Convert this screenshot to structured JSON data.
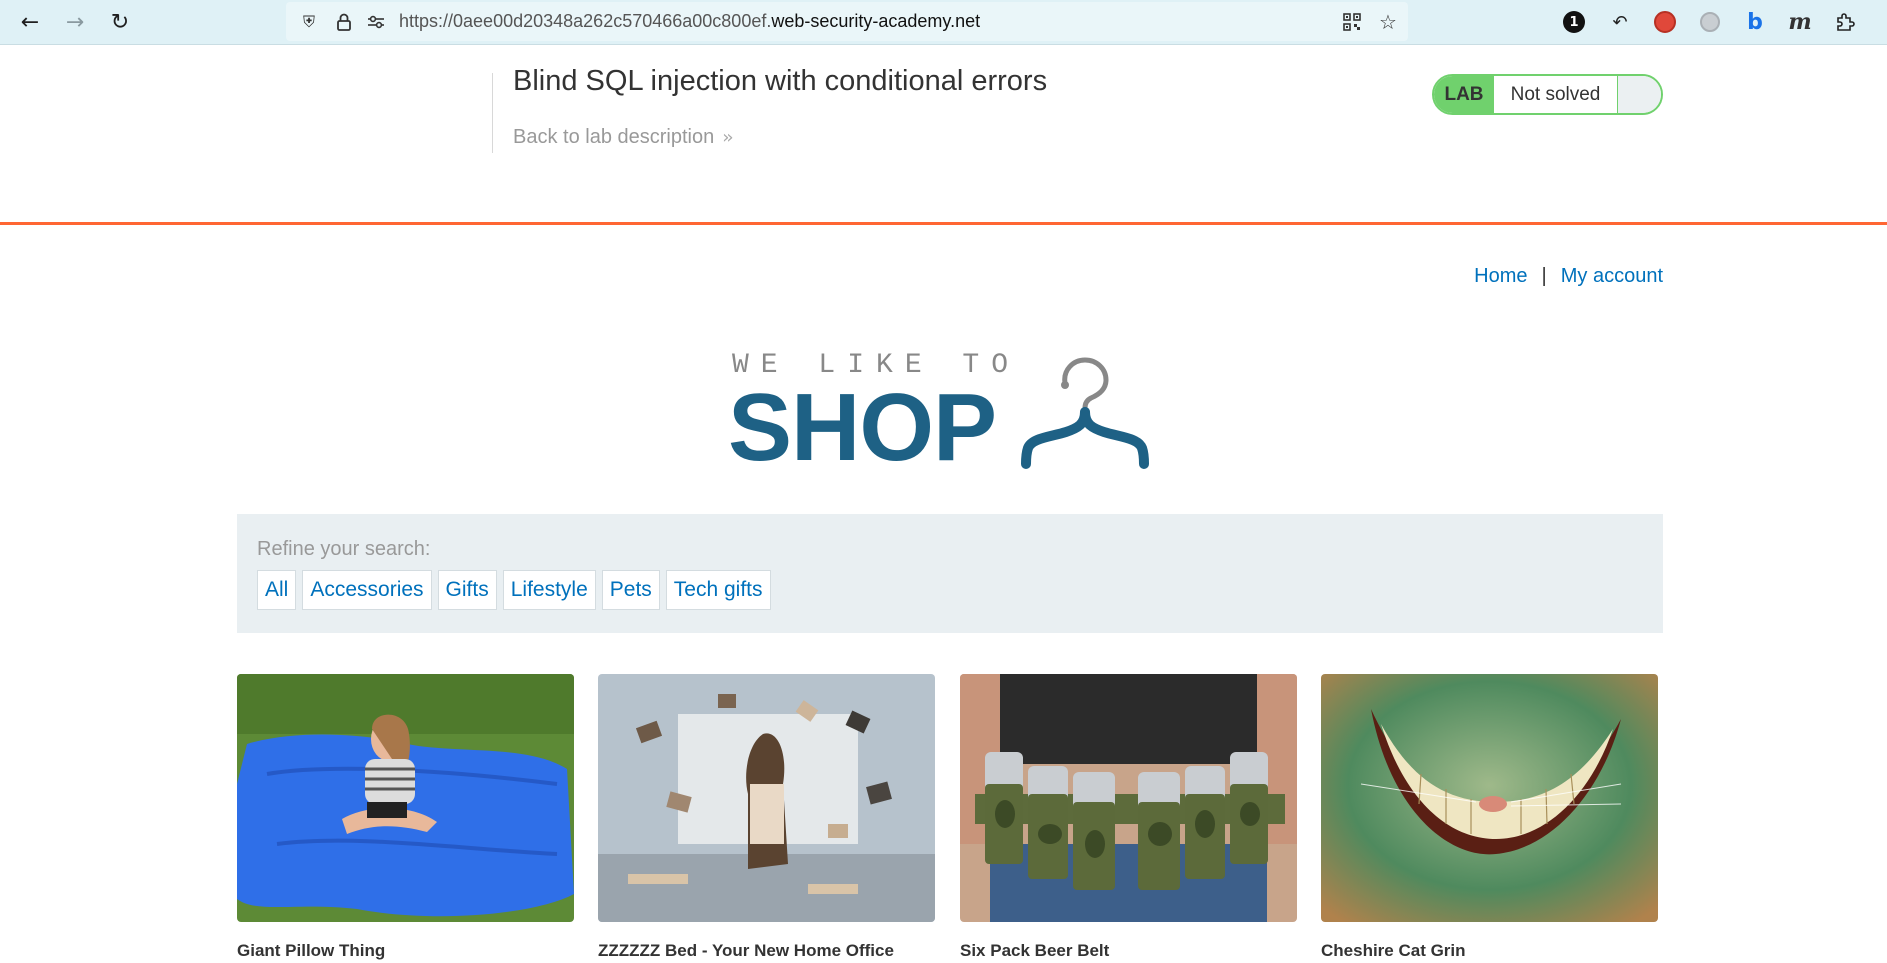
{
  "browser": {
    "back_icon": "arrow-left-icon",
    "forward_icon": "arrow-right-icon",
    "reload_icon": "reload-icon",
    "url_prefix": "https://0aee00d20348a262c570466a00c800ef.",
    "url_domain": "web-security-academy.net",
    "extension_badge_count": "1"
  },
  "lab": {
    "title": "Blind SQL injection with conditional errors",
    "back_link": "Back to lab description",
    "status_tag": "LAB",
    "status_text": "Not solved",
    "status_color": "#70d16d",
    "accent_color": "#ff6633"
  },
  "nav": {
    "home": "Home",
    "separator": "|",
    "account": "My account"
  },
  "logo": {
    "top_text": "WE LIKE TO",
    "main_text": "SHOP",
    "color": "#1e6185"
  },
  "filter": {
    "label": "Refine your search:",
    "categories": [
      "All",
      "Accessories",
      "Gifts",
      "Lifestyle",
      "Pets",
      "Tech gifts"
    ]
  },
  "products": [
    {
      "name": "Giant Pillow Thing"
    },
    {
      "name": "ZZZZZZ Bed - Your New Home Office"
    },
    {
      "name": "Six Pack Beer Belt"
    },
    {
      "name": "Cheshire Cat Grin"
    }
  ]
}
